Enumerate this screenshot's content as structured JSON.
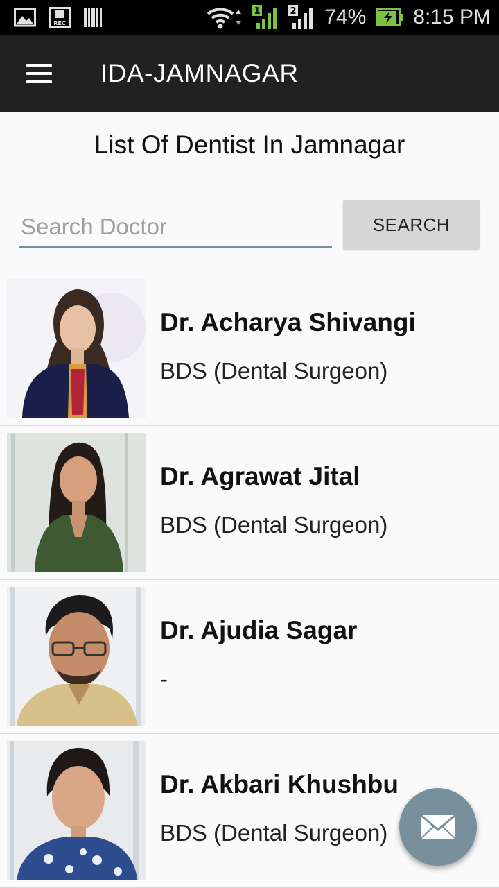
{
  "status_bar": {
    "battery": "74%",
    "time": "8:15 PM",
    "sim1": "1",
    "sim2": "2",
    "rec": "REC"
  },
  "app_bar": {
    "title": "IDA-JAMNAGAR"
  },
  "heading": "List Of Dentist In Jamnagar",
  "search": {
    "placeholder": "Search Doctor",
    "value": "",
    "button_label": "SEARCH"
  },
  "doctors": [
    {
      "name": "Dr. Acharya Shivangi",
      "qualification": "BDS (Dental Surgeon)"
    },
    {
      "name": "Dr. Agrawat Jital",
      "qualification": "BDS (Dental Surgeon)"
    },
    {
      "name": "Dr. Ajudia Sagar",
      "qualification": "-"
    },
    {
      "name": "Dr. Akbari Khushbu",
      "qualification": "BDS (Dental Surgeon)"
    }
  ],
  "fab": {
    "icon": "envelope-icon"
  },
  "colors": {
    "app_bar": "#212121",
    "accent": "#78909c",
    "button": "#d6d6d6"
  }
}
